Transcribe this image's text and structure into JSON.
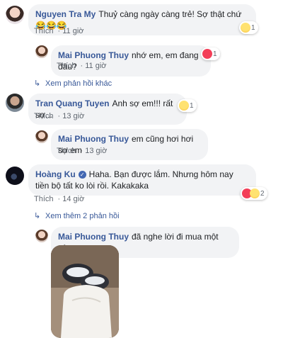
{
  "comments": [
    {
      "author": "Nguyen Tra My",
      "text": "Thuỷ càng ngày càng trẻ! Sợ thật chứ 😂😂😂",
      "like": "Thích",
      "time": "11 giờ",
      "reaction_count": "1",
      "reaction_type": "haha"
    },
    {
      "author": "Mai Phuong Thuy",
      "text": "nhớ em, em đang đâu?",
      "like": "Thích",
      "time": "11 giờ",
      "reaction_count": "1",
      "reaction_type": "heart"
    },
    {
      "author": "Tran Quang Tuyen",
      "text": "Anh sợ em!!! rất sợ...",
      "like": "Thích",
      "time": "13 giờ",
      "reaction_count": "1",
      "reaction_type": "wow"
    },
    {
      "author": "Mai Phuong Thuy",
      "text": "em cũng hơi hơi sợ em",
      "like": "Thích",
      "time": "13 giờ"
    },
    {
      "author": "Hoàng Ku",
      "text": "Haha. Bạn được lắm. Nhưng hôm nay tiền bộ tất ko lòi rồi. Kakakaka",
      "like": "Thích",
      "time": "14 giờ",
      "reaction_count": "2",
      "reaction_type": "haha-heart"
    },
    {
      "author": "Mai Phuong Thuy",
      "text": "đã nghe lời đi mua một sập"
    }
  ],
  "links": {
    "more_replies": "Xem phản hồi khác",
    "more_two_replies": "Xem thêm 2 phản hồi"
  },
  "colors": {
    "name": "#385898",
    "bubble": "#f2f3f5",
    "meta": "#606770"
  }
}
